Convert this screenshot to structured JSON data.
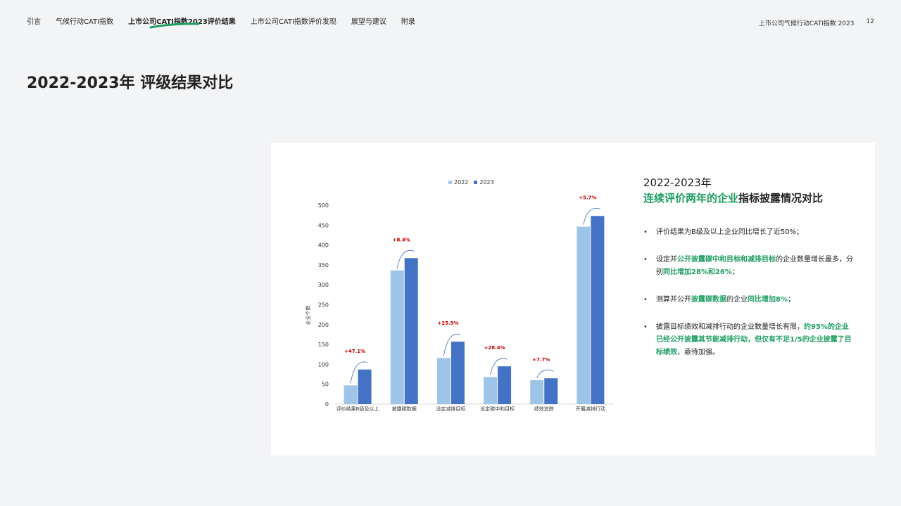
{
  "nav": {
    "items": [
      "引言",
      "气候行动CATI指数",
      "上市公司CATI指数2023评价结果",
      "上市公司CATI指数评价发现",
      "展望与建议",
      "附录"
    ],
    "active_index": 2
  },
  "header": {
    "report_name": "上市公司气候行动CATI指数 2023",
    "page_number": "12"
  },
  "page_title": "2022-2023年 评级结果对比",
  "colors": {
    "series_2022": "#9ec5e8",
    "series_2023": "#4472c4",
    "change_label": "#c00000",
    "accent_green": "#1f9e63"
  },
  "side": {
    "year": "2022-2023年",
    "title_highlight": "连续评价两年的企业",
    "title_rest": "指标披露情况对比",
    "bullets": [
      [
        {
          "text": "评价结果为B级及以上企业同比增长了近50%；",
          "hl": false
        }
      ],
      [
        {
          "text": "设定并",
          "hl": false
        },
        {
          "text": "公开披露碳中和目标和减排目标",
          "hl": true
        },
        {
          "text": "的企业数量增长最多，分别",
          "hl": false
        },
        {
          "text": "同比增加28%和26%",
          "hl": true
        },
        {
          "text": "；",
          "hl": false
        }
      ],
      [
        {
          "text": "测算并公开",
          "hl": false
        },
        {
          "text": "披露碳数据",
          "hl": true
        },
        {
          "text": "的企业",
          "hl": false
        },
        {
          "text": "同比增加8%",
          "hl": true
        },
        {
          "text": "；",
          "hl": false
        }
      ],
      [
        {
          "text": "披露目标绩效和减排行动的企业数量增长有限，",
          "hl": false
        },
        {
          "text": "约95%的企业已经公开披露其节能减排行动，但仅有不足1/5的企业披露了目标绩效",
          "hl": true
        },
        {
          "text": "，亟待加强。",
          "hl": false
        }
      ]
    ]
  },
  "chart_data": {
    "type": "bar",
    "categories": [
      "评价结果B级及以上",
      "披露碳数据",
      "设定减排目标",
      "设定碳中和目标",
      "绩效追踪",
      "开展减排行动"
    ],
    "series": [
      {
        "name": "2022",
        "values": [
          47,
          336,
          116,
          68,
          60,
          446
        ]
      },
      {
        "name": "2023",
        "values": [
          87,
          367,
          157,
          95,
          65,
          473
        ]
      }
    ],
    "change_labels": [
      "+47.1%",
      "+8.4%",
      "+25.9%",
      "+28.4%",
      "+7.7%",
      "+5.7%"
    ],
    "ylabel": "企业个数",
    "ylim": [
      0,
      500
    ],
    "yticks": [
      0,
      50,
      100,
      150,
      200,
      250,
      300,
      350,
      400,
      450,
      500
    ],
    "grid": false,
    "legend": "top-center"
  }
}
